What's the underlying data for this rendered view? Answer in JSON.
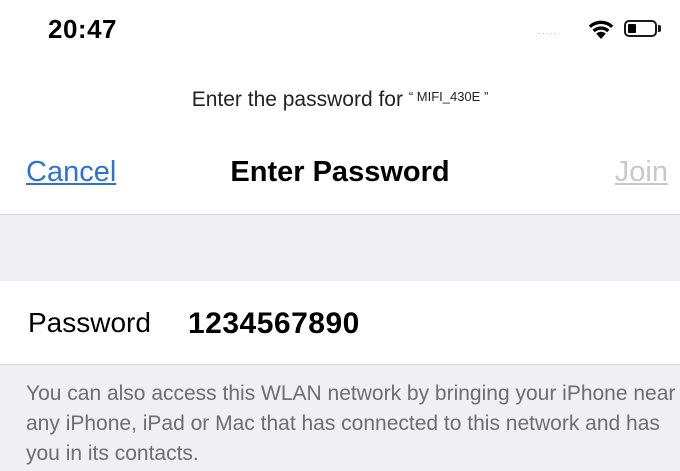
{
  "status_bar": {
    "time": "20:47",
    "signal_text": ".....",
    "wifi_icon": "wifi-icon",
    "battery_icon": "battery-icon",
    "battery_level": 0.25
  },
  "prompt": {
    "prefix": "Enter the password for ",
    "network_name": "“ MIFI_430E ”"
  },
  "navbar": {
    "cancel_label": "Cancel",
    "title": "Enter Password",
    "join_label": "Join"
  },
  "password": {
    "label": "Password",
    "value": "1234567890"
  },
  "footer": {
    "text": "You can also access this WLAN network by bringing your iPhone near any iPhone, iPad or Mac that has connected to this network and has you in its contacts."
  },
  "colors": {
    "accent": "#2e72d2",
    "disabled": "#c8c8cc",
    "grouped_background": "#efeff4",
    "footer_text": "#6d6d72"
  }
}
